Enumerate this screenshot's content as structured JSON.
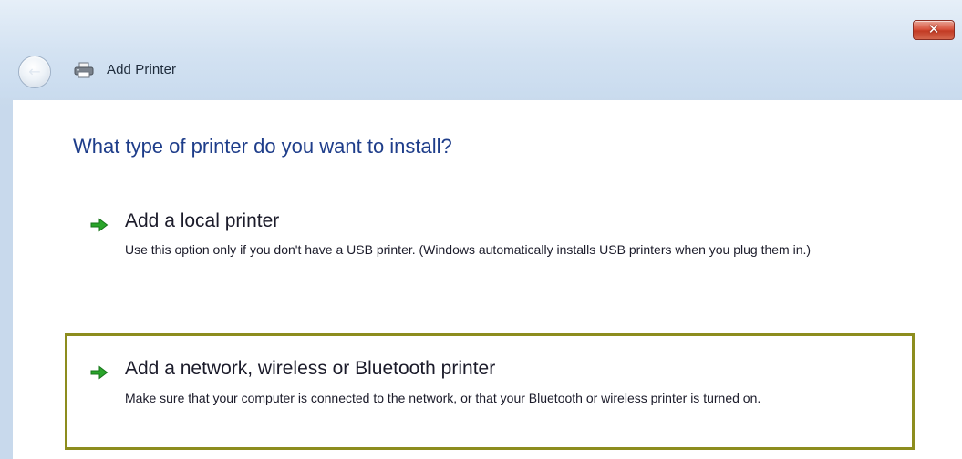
{
  "window": {
    "title": "Add Printer",
    "close_symbol": "✕",
    "back_symbol": "←"
  },
  "icons": {
    "back": "arrow-left-icon",
    "printer": "printer-icon",
    "close": "close-icon",
    "option_arrow": "arrow-right-icon"
  },
  "colors": {
    "heading": "#1e3d8a",
    "selection_border": "#8d8d1e",
    "option_arrow": "#2aa52a",
    "close_button": "#d8553f"
  },
  "main": {
    "heading": "What type of printer do you want to install?",
    "options": [
      {
        "title": "Add a local printer",
        "description": "Use this option only if you don't have a USB printer. (Windows automatically installs USB printers when you plug them in.)",
        "selected": false
      },
      {
        "title": "Add a network, wireless or Bluetooth printer",
        "description": "Make sure that your computer is connected to the network, or that your Bluetooth or wireless printer is turned on.",
        "selected": true
      }
    ]
  }
}
